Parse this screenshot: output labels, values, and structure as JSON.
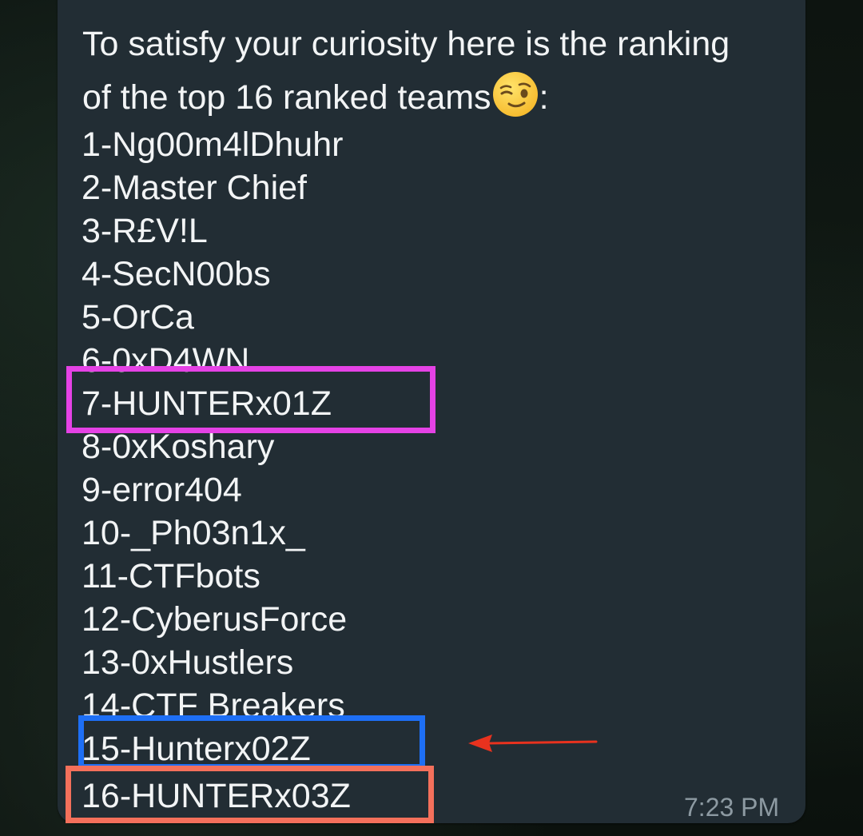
{
  "message": {
    "intro_line1": "To satisfy your curiosity here is the ranking",
    "intro_line2": "of the top 16 ranked teams",
    "intro_suffix": ":",
    "emoji": "smirking-wink-emoji",
    "time": "7:23 PM"
  },
  "rankings": [
    "1-Ng00m4lDhuhr",
    "2-Master Chief",
    "3-R£V!L",
    "4-SecN00bs",
    "5-OrCa",
    "6-0xD4WN",
    "7-HUNTERx01Z",
    "8-0xKoshary",
    "9-error404",
    "10-_Ph03n1x_",
    "11-CTFbots",
    "12-CyberusForce",
    "13-0xHustlers",
    "14-CTF Breakers",
    "15-Hunterx02Z",
    "16-HUNTERx03Z"
  ],
  "annotations": {
    "magenta_box": "#e542e5",
    "blue_box": "#1e6ff5",
    "salmon_box": "#f4705b",
    "arrow_color": "#e8321e"
  },
  "colors": {
    "bubble": "#222d34",
    "text": "#f2f4f5",
    "timestamp": "#8d9aa2"
  }
}
